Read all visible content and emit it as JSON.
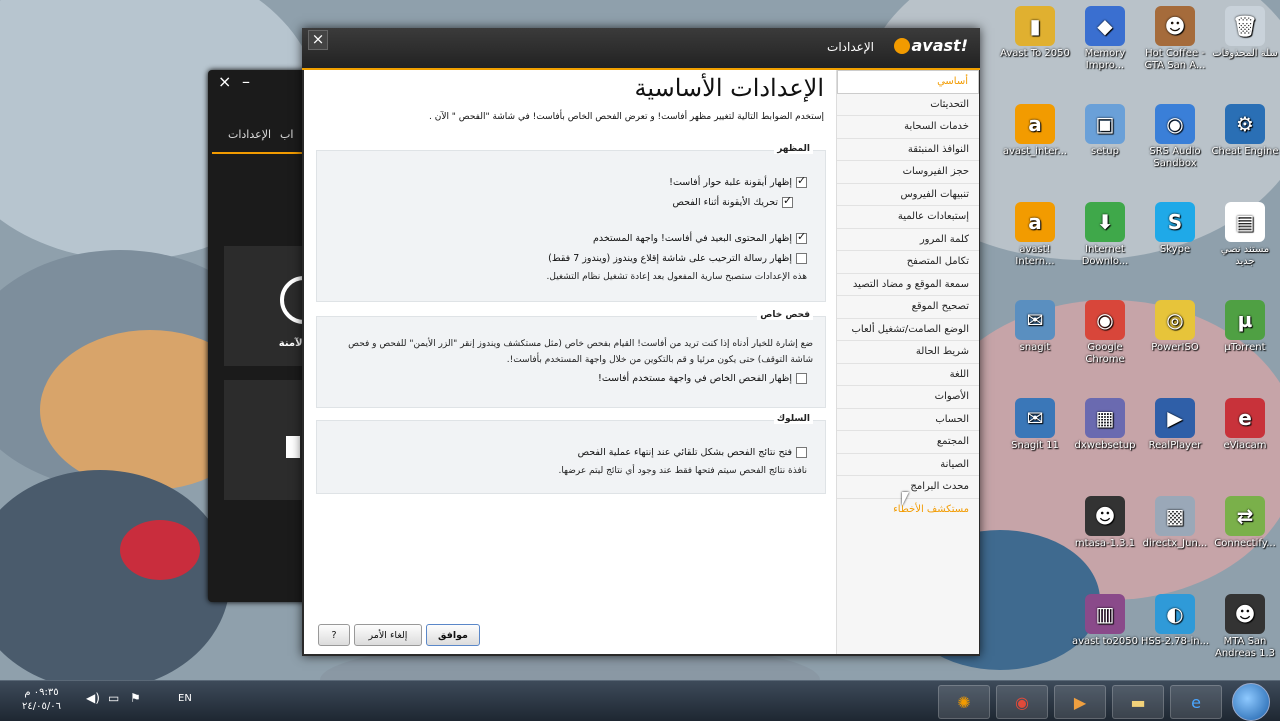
{
  "desktop": {
    "icons": [
      {
        "label": "سلة المحذوفات",
        "glyph": "🗑",
        "color": "#c9d2da"
      },
      {
        "label": "Hot Coffee - GTA San A...",
        "glyph": "☻",
        "color": "#a56b3b"
      },
      {
        "label": "Memory Impro...",
        "glyph": "◆",
        "color": "#3a6fd0"
      },
      {
        "label": "Avast To 2050",
        "glyph": "▮",
        "color": "#e0b030"
      },
      {
        "label": "Cheat Engine",
        "glyph": "⚙",
        "color": "#2a6fb5"
      },
      {
        "label": "SRS Audio Sandbox",
        "glyph": "◉",
        "color": "#3a7fd8"
      },
      {
        "label": "setup",
        "glyph": "▣",
        "color": "#6aa0d8"
      },
      {
        "label": "avast_inter...",
        "glyph": "a",
        "color": "#f29b00"
      },
      {
        "label": "مستند نصي جديد",
        "glyph": "▤",
        "color": "#ffffff"
      },
      {
        "label": "Skype",
        "glyph": "S",
        "color": "#1fa9e8"
      },
      {
        "label": "Internet Downlo...",
        "glyph": "⬇",
        "color": "#3fa84a"
      },
      {
        "label": "avast! Intern...",
        "glyph": "a",
        "color": "#f29b00"
      },
      {
        "label": "µTorrent",
        "glyph": "µ",
        "color": "#4fa043"
      },
      {
        "label": "PowerISO",
        "glyph": "◎",
        "color": "#e7c43a"
      },
      {
        "label": "Google Chrome",
        "glyph": "◉",
        "color": "#d8463a"
      },
      {
        "label": "snagit",
        "glyph": "✉",
        "color": "#5a8fc0"
      },
      {
        "label": "eViacam",
        "glyph": "e",
        "color": "#c8323a"
      },
      {
        "label": "RealPlayer",
        "glyph": "▶",
        "color": "#2f5fa8"
      },
      {
        "label": "dxwebsetup",
        "glyph": "▦",
        "color": "#6a6ab0"
      },
      {
        "label": "Snagit 11",
        "glyph": "✉",
        "color": "#3a77b8"
      },
      {
        "label": "Connectify...",
        "glyph": "⇄",
        "color": "#7ab04a"
      },
      {
        "label": "directx_Jun...",
        "glyph": "▩",
        "color": "#9aa8b8"
      },
      {
        "label": "mtasa-1.3.1",
        "glyph": "☻",
        "color": "#333333"
      },
      {
        "label": "MTA San Andreas 1.3",
        "glyph": "☻",
        "color": "#333333"
      },
      {
        "label": "HSS-2.78-in...",
        "glyph": "◐",
        "color": "#2f9ad8"
      },
      {
        "label": "avast to2050",
        "glyph": "▥",
        "color": "#8a4a8a"
      }
    ]
  },
  "background_window": {
    "close": "×",
    "minimize": "–",
    "tab_settings": "الإعدادات",
    "tab_partial": "اب",
    "panel_label": "الآمنة"
  },
  "dialog": {
    "brand": "avast!",
    "title": "الإعدادات",
    "close": "×",
    "heading": "الإعدادات الأساسية",
    "intro": "إستخدم الضوابط التالية لتغيير مظهر أفاست! و تعرض الفحص الخاص بأفاست! في شاشة \"الفحص \" الآن .",
    "sections": {
      "appearance": {
        "title": "المظهر",
        "opt1": "إظهار أيقونة علبة حوار أفاست!",
        "opt2": "تحريك الأيقونة أثناء الفحص",
        "opt3": "إظهار المحتوى البعيد في أفاست! واجهة المستخدم",
        "opt4": "إظهار رسالة الترحيب على شاشة إقلاع ويندوز (ويندوز 7 فقط)",
        "note": "هذه الإعدادات ستصبح سارية المفعول بعد إعادة تشغيل نظام التشغيل."
      },
      "custom_scan": {
        "title": "فحص خاص",
        "desc1": "ضع إشارة للخيار أدناه إذا كنت تريد من أفاست! القيام بفحص خاص (مثل مستكشف ويندوز إنقر \"الزر الأيمن\" للفحص و فحص",
        "desc2": "شاشة التوقف) حتى يكون مرئيا و قم بالتكوين من خلال واجهة المستخدم بأفاست!.",
        "opt1": "إظهار الفحص الخاص في واجهة مستخدم أفاست!"
      },
      "behavior": {
        "title": "السلوك",
        "opt1": "فتح نتائج الفحص بشكل تلقائي عند إنتهاء عملية الفحص",
        "note": "نافذة نتائج الفحص سيتم فتحها فقط عند وجود أي نتائج ليتم عرضها."
      }
    },
    "sidebar": [
      "أساسي",
      "التحديثات",
      "خدمات السحابة",
      "النوافذ المنبثقة",
      "حجز الفيروسات",
      "تنبيهات الفيروس",
      "إستبعادات عالمية",
      "كلمة المرور",
      "تكامل المتصفح",
      "سمعة الموقع و مضاد التصيد",
      "تصحيح الموقع",
      "الوضع الصامت/تشغيل ألعاب",
      "شريط الحالة",
      "اللغة",
      "الأصوات",
      "الحساب",
      "المجتمع",
      "الصيانة",
      "محدث البرامج",
      "مستكشف الأخطاء"
    ],
    "buttons": {
      "ok": "موافق",
      "cancel": "إلغاء الأمر",
      "help": "?"
    }
  },
  "taskbar": {
    "language": "EN",
    "time": "٠٩:٣٥ م",
    "date": "٢٤/٠٥/٠٦"
  }
}
